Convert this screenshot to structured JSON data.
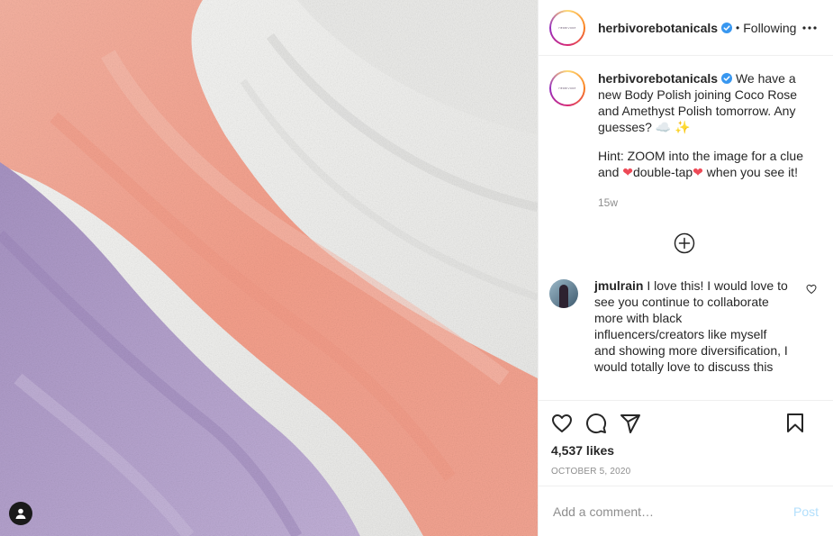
{
  "header": {
    "username": "herbivorebotanicals",
    "separator": "•",
    "follow_status": "Following",
    "avatar_logo_text": "HERBIVORE"
  },
  "caption": {
    "username": "herbivorebotanicals",
    "text": "We have a new Body Polish joining Coco Rose and Amethyst Polish tomorrow. Any guesses? ☁️ ✨",
    "hint_prefix": "Hint: ZOOM into the image for a clue and",
    "hint_middle": "double-tap",
    "hint_suffix": "when you see it!",
    "heart_emoji": "❤",
    "time": "15w"
  },
  "comment": {
    "username": "jmulrain",
    "text": "I love this! I would love to see you continue to collaborate more with black influencers/creators like myself and showing more diversification, I would totally love to discuss this"
  },
  "stats": {
    "likes": "4,537 likes",
    "date": "OCTOBER 5, 2020"
  },
  "add_comment": {
    "placeholder": "Add a comment…",
    "post_label": "Post"
  },
  "colors": {
    "verified": "#3897f0",
    "post_disabled": "#b2dffc",
    "lavender": "#b7a3cf",
    "peach": "#f6a592",
    "white_scrub": "#f3f3f1"
  },
  "icons": [
    "verified-icon",
    "more-options-icon",
    "load-more-icon",
    "like-comment-icon",
    "heart-icon",
    "comment-icon",
    "share-icon",
    "save-icon",
    "user-tag-icon"
  ]
}
